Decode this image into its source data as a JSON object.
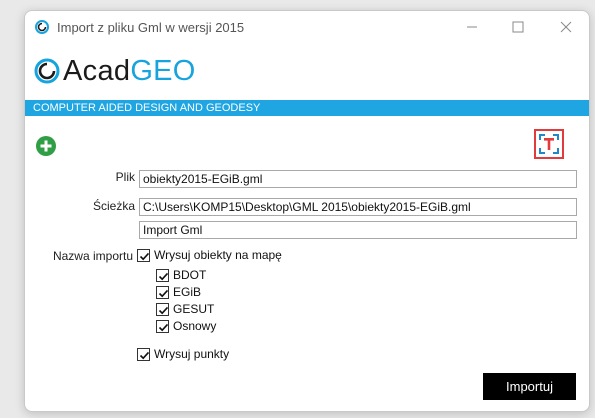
{
  "window": {
    "title": "Import z pliku Gml w wersji 2015"
  },
  "logo": {
    "part1": "Acad",
    "part2": "GEO"
  },
  "banner": {
    "text": "COMPUTER AIDED DESIGN AND GEODESY"
  },
  "form": {
    "file_label": "Plik",
    "file_value": "obiekty2015-EGiB.gml",
    "path_label": "Ścieżka",
    "path_value": "C:\\Users\\KOMP15\\Desktop\\GML 2015\\obiekty2015-EGiB.gml",
    "import_name_label": "Nazwa importu",
    "import_name_value": "Import Gml"
  },
  "options": {
    "draw_objects": "Wrysuj obiekty na mapę",
    "bdot": "BDOT",
    "egib": "EGiB",
    "gesut": "GESUT",
    "osnowy": "Osnowy",
    "draw_points": "Wrysuj punkty"
  },
  "buttons": {
    "import": "Importuj"
  },
  "colors": {
    "accent": "#1ea5e2",
    "add_green": "#2f9e44",
    "highlight": "#e23b3b"
  }
}
